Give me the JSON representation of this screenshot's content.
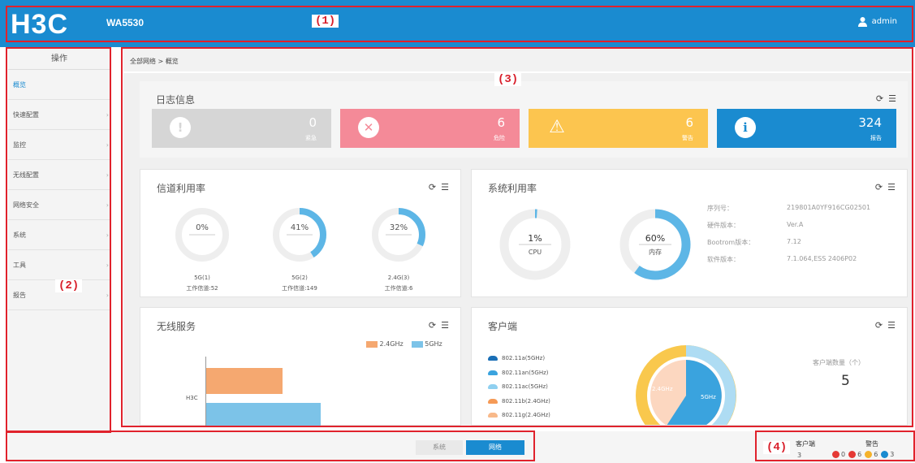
{
  "header": {
    "logo": "H3C",
    "model": "WA5530",
    "user": "admin"
  },
  "markers": {
    "m1": "(1)",
    "m2": "(2)",
    "m3": "(3)",
    "m4": "(4)"
  },
  "sidebar": {
    "title": "操作",
    "items": [
      {
        "label": "概览",
        "arrow": ""
      },
      {
        "label": "快速配置",
        "arrow": "›"
      },
      {
        "label": "监控",
        "arrow": "›"
      },
      {
        "label": "无线配置",
        "arrow": "›"
      },
      {
        "label": "网络安全",
        "arrow": "›"
      },
      {
        "label": "系统",
        "arrow": "›"
      },
      {
        "label": "工具",
        "arrow": "›"
      },
      {
        "label": "报告",
        "arrow": "›"
      }
    ]
  },
  "breadcrumb": "全部网络 > 概览",
  "log": {
    "title": "日志信息",
    "boxes": [
      {
        "count": "0",
        "label": "紧急",
        "color": "#d6d6d6",
        "glyph": "!"
      },
      {
        "count": "6",
        "label": "危险",
        "color": "#f48a98",
        "glyph": "✕"
      },
      {
        "count": "6",
        "label": "警告",
        "color": "#fcc54f",
        "glyph": "⚠"
      },
      {
        "count": "324",
        "label": "报告",
        "color": "#1a8bd0",
        "glyph": "i"
      }
    ]
  },
  "channel": {
    "title": "信道利用率",
    "items": [
      {
        "pct": "0%",
        "value": 0,
        "radio": "5G(1)",
        "channel": "工作信道:52"
      },
      {
        "pct": "41%",
        "value": 0.41,
        "radio": "5G(2)",
        "channel": "工作信道:149"
      },
      {
        "pct": "32%",
        "value": 0.32,
        "radio": "2.4G(3)",
        "channel": "工作信道:6"
      }
    ]
  },
  "system": {
    "title": "系统利用率",
    "gauges": [
      {
        "pct": "1%",
        "name": "CPU",
        "value": 0.01
      },
      {
        "pct": "60%",
        "name": "内存",
        "value": 0.6
      }
    ],
    "info": [
      {
        "k": "序列号：",
        "v": "219801A0YF916CG02501"
      },
      {
        "k": "硬件版本：",
        "v": "Ver.A"
      },
      {
        "k": "Bootrom版本：",
        "v": "7.12"
      },
      {
        "k": "软件版本：",
        "v": "7.1.064,ESS 2406P02"
      }
    ]
  },
  "wireless": {
    "title": "无线服务",
    "legend": [
      {
        "name": "2.4GHz",
        "color": "#f5a870"
      },
      {
        "name": "5GHz",
        "color": "#7cc3e8"
      }
    ],
    "category": "H3C"
  },
  "clients": {
    "title": "客户端",
    "types": [
      {
        "name": "802.11a(5GHz)",
        "color": "#1a6fb6"
      },
      {
        "name": "802.11an(5GHz)",
        "color": "#3aa3de"
      },
      {
        "name": "802.11ac(5GHz)",
        "color": "#8fd0f0"
      },
      {
        "name": "802.11b(2.4GHz)",
        "color": "#f59a56"
      },
      {
        "name": "802.11g(2.4GHz)",
        "color": "#f8b98a"
      }
    ],
    "pie_inner": {
      "a": "2.4GHz",
      "b": "5GHz"
    },
    "count_label": "客户端数量（个）",
    "count": "5"
  },
  "footer": {
    "tab1": "系统",
    "tab2": "网络",
    "client_label": "客户端",
    "client_value": "3",
    "alarm_label": "警告",
    "alarms": [
      {
        "v": "0",
        "c": "#e53935"
      },
      {
        "v": "6",
        "c": "#e53935"
      },
      {
        "v": "6",
        "c": "#f5b22a"
      },
      {
        "v": "3",
        "c": "#1a8bd0"
      }
    ]
  }
}
